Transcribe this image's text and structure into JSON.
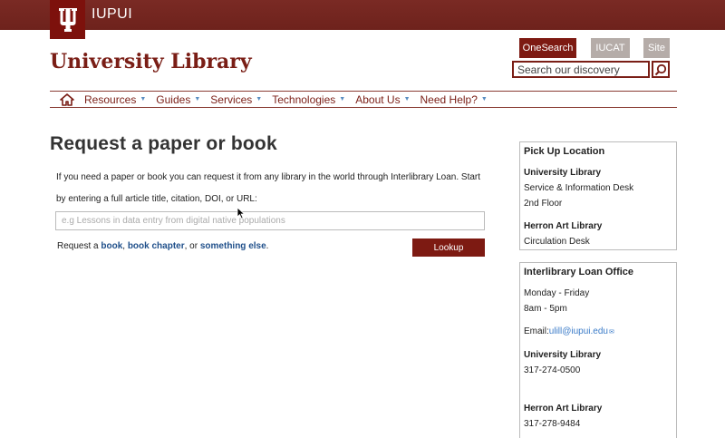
{
  "brand": {
    "campus": "IUPUI",
    "accent": "#7d110c"
  },
  "header": {
    "title": "University Library",
    "buttons": {
      "onesearch": "OneSearch",
      "iucat": "IUCAT",
      "site": "Site"
    },
    "search_placeholder": "Search our discovery"
  },
  "nav": {
    "items": [
      "Resources",
      "Guides",
      "Services",
      "Technologies",
      "About Us",
      "Need Help?"
    ]
  },
  "main": {
    "title": "Request a paper or book",
    "intro": "If you need a paper or book you can request it from any library in the world through Interlibrary Loan. Start by entering a full article title, citation, DOI, or URL:",
    "input_placeholder": "e.g Lessons in data entry from digital native populations",
    "request_prefix": "Request a ",
    "link_book": "book",
    "sep1": ", ",
    "link_chapter": "book chapter",
    "sep2": ", or ",
    "link_else": "something else",
    "suffix": ".",
    "lookup_label": "Lookup"
  },
  "pickup": {
    "title": "Pick Up Location",
    "loc1_name": "University Library",
    "loc1_line1": "Service & Information Desk",
    "loc1_line2": "2nd Floor",
    "loc2_name": "Herron Art Library",
    "loc2_line1": "Circulation Desk"
  },
  "ill": {
    "title": "Interlibrary Loan Office",
    "days": "Monday - Friday",
    "hours": "8am - 5pm",
    "email_label": "Email:",
    "email": "ulill@iupui.edu",
    "lib1_name": "University Library",
    "lib1_phone": "317-274-0500",
    "lib2_name": "Herron Art Library",
    "lib2_phone": "317-278-9484"
  }
}
